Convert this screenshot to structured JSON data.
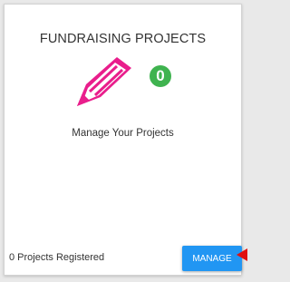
{
  "card": {
    "title": "FUNDRAISING PROJECTS",
    "icon": "pencil-icon",
    "icon_color": "#e91e8c",
    "badge_count": "0",
    "badge_color": "#3fb34f",
    "subtitle": "Manage Your Projects",
    "footer_text": "0 Projects Registered",
    "manage_label": "MANAGE",
    "button_color": "#2196f3"
  },
  "annotation": {
    "pointer": "arrow-icon",
    "pointer_color": "#e01010"
  }
}
